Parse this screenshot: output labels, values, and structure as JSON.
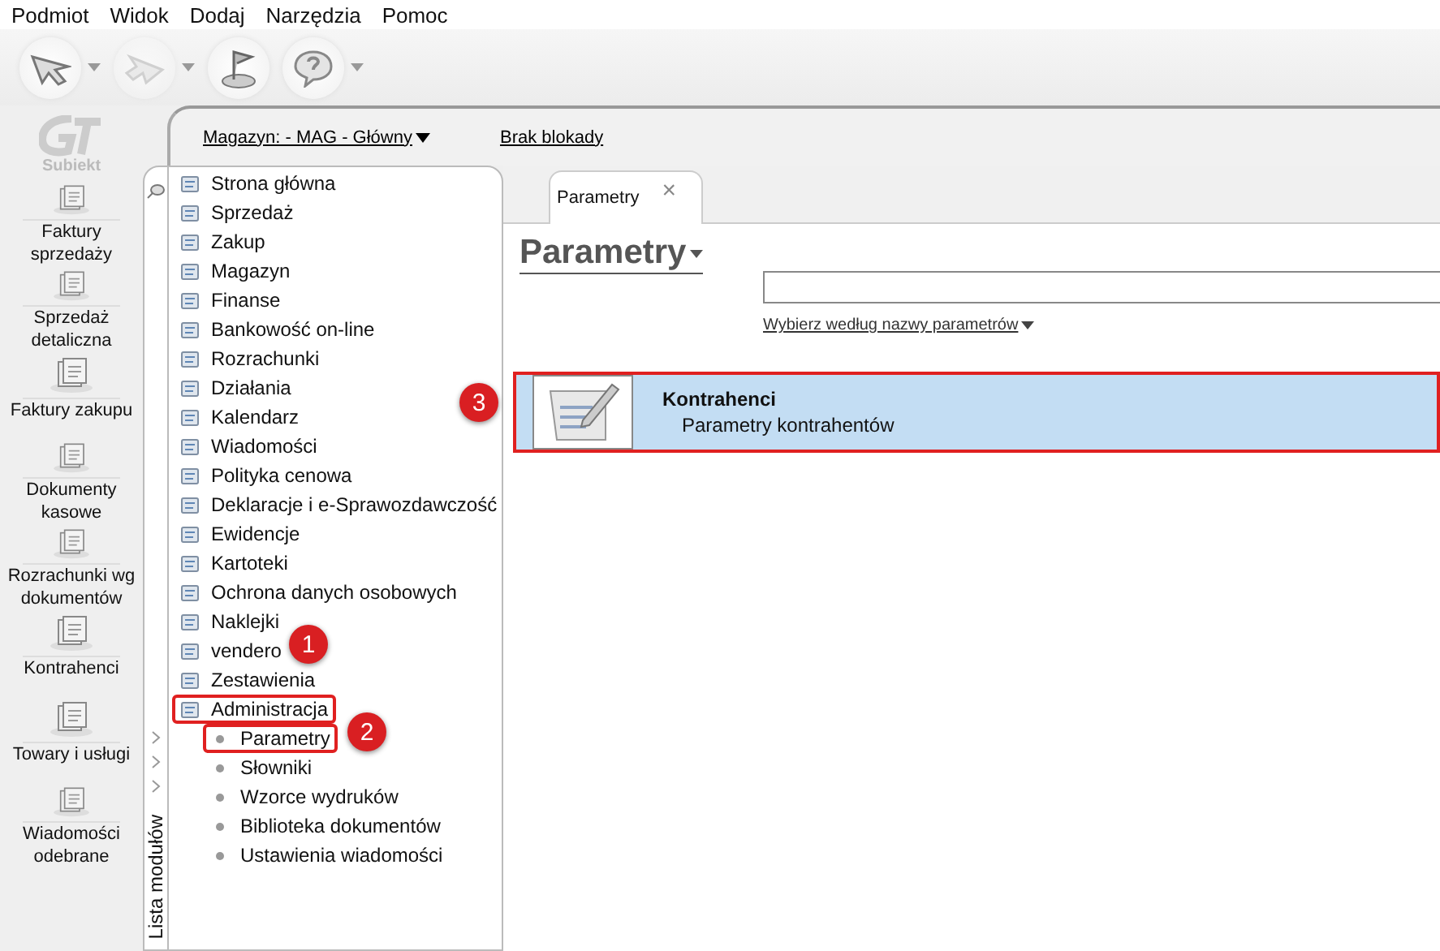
{
  "menu": [
    "Podmiot",
    "Widok",
    "Dodaj",
    "Narzędzia",
    "Pomoc"
  ],
  "toolbar": [
    {
      "kind": "back",
      "dropdown": true,
      "disabled": false
    },
    {
      "kind": "forward",
      "dropdown": true,
      "disabled": true
    },
    {
      "kind": "flag",
      "dropdown": false,
      "disabled": false
    },
    {
      "kind": "help",
      "dropdown": true,
      "disabled": false
    }
  ],
  "logo": {
    "text": "Subiekt"
  },
  "sidebar": {
    "items": [
      {
        "label": "Faktury sprzedaży"
      },
      {
        "label": "Sprzedaż detaliczna"
      },
      {
        "label": "Faktury zakupu"
      },
      {
        "label": "Dokumenty kasowe"
      },
      {
        "label": "Rozrachunki wg dokumentów"
      },
      {
        "label": "Kontrahenci"
      },
      {
        "label": "Towary i usługi"
      },
      {
        "label": "Wiadomości odebrane"
      }
    ]
  },
  "header": {
    "warehouse": "Magazyn: - MAG - Główny",
    "lock": "Brak blokady"
  },
  "modules": {
    "title": "Lista modułów",
    "items": [
      {
        "label": "Strona główna",
        "highlighted": false
      },
      {
        "label": "Sprzedaż",
        "highlighted": false
      },
      {
        "label": "Zakup",
        "highlighted": false
      },
      {
        "label": "Magazyn",
        "highlighted": false
      },
      {
        "label": "Finanse",
        "highlighted": false
      },
      {
        "label": "Bankowość on-line",
        "highlighted": false
      },
      {
        "label": "Rozrachunki",
        "highlighted": false
      },
      {
        "label": "Działania",
        "highlighted": false
      },
      {
        "label": "Kalendarz",
        "highlighted": false
      },
      {
        "label": "Wiadomości",
        "highlighted": false
      },
      {
        "label": "Polityka cenowa",
        "highlighted": false
      },
      {
        "label": "Deklaracje i e-Sprawozdawczość",
        "highlighted": false
      },
      {
        "label": "Ewidencje",
        "highlighted": false
      },
      {
        "label": "Kartoteki",
        "highlighted": false
      },
      {
        "label": "Ochrona danych osobowych",
        "highlighted": false
      },
      {
        "label": "Naklejki",
        "highlighted": false
      },
      {
        "label": "vendero",
        "highlighted": false
      },
      {
        "label": "Zestawienia",
        "highlighted": false
      },
      {
        "label": "Administracja",
        "highlighted": true,
        "expanded": true,
        "children": [
          {
            "label": "Parametry",
            "highlighted": true
          },
          {
            "label": "Słowniki",
            "highlighted": false
          },
          {
            "label": "Wzorce wydruków",
            "highlighted": false
          },
          {
            "label": "Biblioteka dokumentów",
            "highlighted": false
          },
          {
            "label": "Ustawienia wiadomości",
            "highlighted": false
          }
        ]
      }
    ]
  },
  "tabs": [
    {
      "label": "Parametry",
      "selected": true,
      "close": "×"
    }
  ],
  "page": {
    "title": "Parametry",
    "filter": "Wybierz według nazwy parametrów"
  },
  "results": [
    {
      "title": "Kontrahenci",
      "description": "Parametry kontrahentów",
      "highlighted": true
    }
  ],
  "callouts": [
    {
      "number": "1"
    },
    {
      "number": "2"
    },
    {
      "number": "3"
    }
  ]
}
